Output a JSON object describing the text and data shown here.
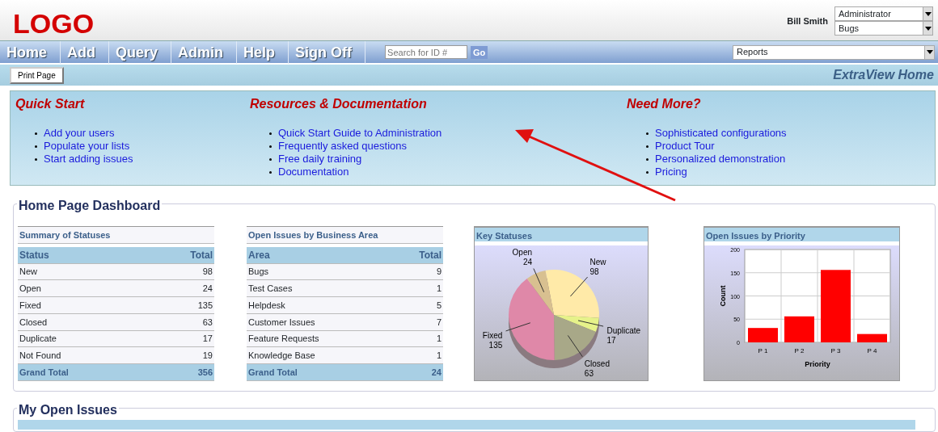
{
  "header": {
    "logo": "LOGO",
    "user_name": "Bill Smith",
    "role_select": "Administrator",
    "project_select": "Bugs"
  },
  "nav": {
    "items": [
      "Home",
      "Add",
      "Query",
      "Admin",
      "Help",
      "Sign Off"
    ],
    "search_placeholder": "Search for ID #",
    "go_button": "Go",
    "reports_select": "Reports"
  },
  "toolbar": {
    "print_button": "Print Page",
    "page_title": "ExtraView Home"
  },
  "quick_links": [
    {
      "title": "Quick Start",
      "links": [
        "Add your users",
        "Populate your lists",
        "Start adding issues"
      ]
    },
    {
      "title": "Resources & Documentation",
      "links": [
        "Quick Start Guide to Administration",
        "Frequently asked questions",
        "Free daily training",
        "Documentation"
      ]
    },
    {
      "title": "Need More?",
      "links": [
        "Sophisticated configurations",
        "Product Tour",
        "Personalized demonstration",
        "Pricing"
      ]
    }
  ],
  "dashboard": {
    "title": "Home Page Dashboard",
    "tables": [
      {
        "title": "Summary of Statuses",
        "columns": [
          "Status",
          "Total"
        ],
        "rows": [
          [
            "New",
            "98"
          ],
          [
            "Open",
            "24"
          ],
          [
            "Fixed",
            "135"
          ],
          [
            "Closed",
            "63"
          ],
          [
            "Duplicate",
            "17"
          ],
          [
            "Not Found",
            "19"
          ]
        ],
        "total": [
          "Grand Total",
          "356"
        ]
      },
      {
        "title": "Open Issues by Business Area",
        "columns": [
          "Area",
          "Total"
        ],
        "rows": [
          [
            "Bugs",
            "9"
          ],
          [
            "Test Cases",
            "1"
          ],
          [
            "Helpdesk",
            "5"
          ],
          [
            "Customer Issues",
            "7"
          ],
          [
            "Feature Requests",
            "1"
          ],
          [
            "Knowledge Base",
            "1"
          ]
        ],
        "total": [
          "Grand Total",
          "24"
        ]
      }
    ],
    "pie": {
      "title": "Key Statuses",
      "chart_data": {
        "type": "pie",
        "categories": [
          "New",
          "Duplicate",
          "Closed",
          "Fixed",
          "Open"
        ],
        "values": [
          98,
          17,
          63,
          135,
          24
        ],
        "data_labels": true
      }
    },
    "bar": {
      "title": "Open Issues by Priority",
      "chart_data": {
        "type": "bar",
        "xlabel": "Priority",
        "ylabel": "Count",
        "categories": [
          "P 1",
          "P 2",
          "P 3",
          "P 4"
        ],
        "values": [
          31,
          56,
          156,
          18
        ],
        "ylim": [
          0,
          200
        ],
        "yticks": [
          0,
          50,
          100,
          150,
          200
        ],
        "grid": true
      }
    }
  },
  "my_issues": {
    "title": "My Open Issues"
  }
}
